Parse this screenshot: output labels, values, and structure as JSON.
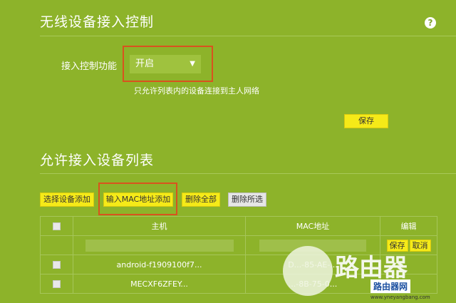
{
  "section1": {
    "title": "无线设备接入控制",
    "help": "?",
    "access_label": "接入控制功能",
    "access_value": "开启",
    "hint": "只允许列表内的设备连接到主人网络",
    "save": "保存"
  },
  "section2": {
    "title": "允许接入设备列表",
    "btn_select_add": "选择设备添加",
    "btn_mac_add": "输入MAC地址添加",
    "btn_delete_all": "删除全部",
    "btn_delete_selected": "删除所选"
  },
  "table": {
    "headers": [
      "主机",
      "MAC地址",
      "编辑"
    ],
    "edit_save": "保存",
    "edit_cancel": "取消",
    "rows": [
      {
        "host": "android-f1909100f7...",
        "mac": "D...-85-AE-..."
      },
      {
        "host": "MECXF6ZFEY...",
        "mac": "...-8B-75-0..."
      }
    ]
  },
  "watermark": {
    "text": "路由器",
    "sub": "路由器网",
    "url": "www.yneyangbang.com"
  }
}
